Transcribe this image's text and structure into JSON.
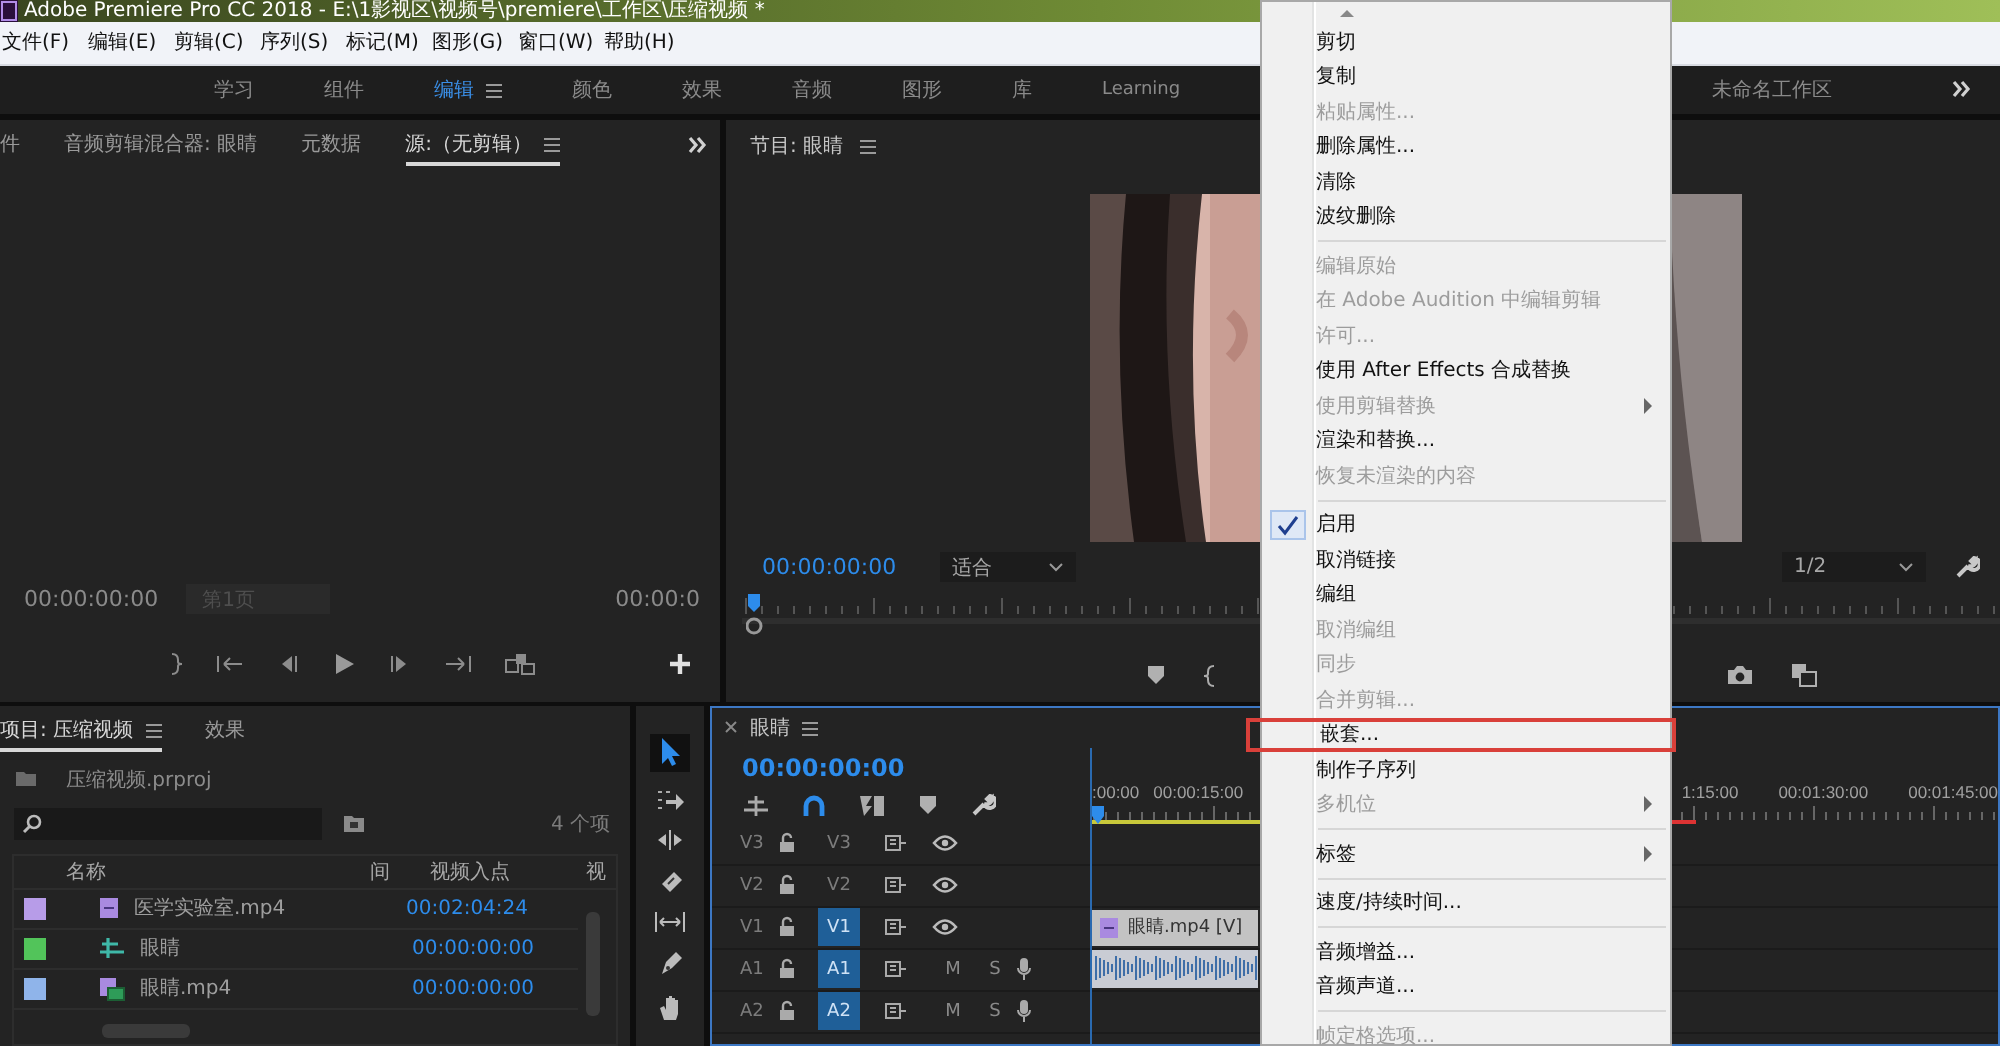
{
  "title_bar": {
    "title": "Adobe Premiere Pro CC 2018 - E:\\1影视区\\视频号\\premiere\\工作区\\压缩视频 *"
  },
  "menu_bar": [
    "文件(F)",
    "编辑(E)",
    "剪辑(C)",
    "序列(S)",
    "标记(M)",
    "图形(G)",
    "窗口(W)",
    "帮助(H)"
  ],
  "workspaces": [
    {
      "label": "学习",
      "selected": false
    },
    {
      "label": "组件",
      "selected": false
    },
    {
      "label": "编辑",
      "selected": true
    },
    {
      "label": "颜色",
      "selected": false
    },
    {
      "label": "效果",
      "selected": false
    },
    {
      "label": "音频",
      "selected": false
    },
    {
      "label": "图形",
      "selected": false
    },
    {
      "label": "库",
      "selected": false
    },
    {
      "label": "Learning",
      "selected": false
    }
  ],
  "workspace_extra": "未命名工作区",
  "source_panel": {
    "tabs": [
      {
        "label": "件",
        "selected": false
      },
      {
        "label": "音频剪辑混合器: 眼睛",
        "selected": false
      },
      {
        "label": "元数据",
        "selected": false
      },
      {
        "label": "源:（无剪辑）",
        "selected": true
      }
    ],
    "timecode": "00:00:00:00",
    "page_field": "第1页",
    "duration": "00:00:0"
  },
  "program_panel": {
    "title": "节目: 眼睛",
    "timecode": "00:00:00:00",
    "fit": "适合",
    "resolution": "1/2"
  },
  "project_panel": {
    "tabs": [
      {
        "label": "项目: 压缩视频",
        "selected": true
      },
      {
        "label": "效果",
        "selected": false
      }
    ],
    "project_file": "压缩视频.prproj",
    "item_count": "4 个项",
    "columns": [
      "名称",
      "间",
      "视频入点",
      "视"
    ],
    "rows": [
      {
        "kind": "media",
        "name": "医学实验室.mp4",
        "in_point": "00:02:04:24",
        "color": "#b79ce8"
      },
      {
        "kind": "sequence",
        "name": "眼睛",
        "in_point": "00:00:00:00",
        "color": "#52c45a"
      },
      {
        "kind": "linked_media",
        "name": "眼睛.mp4",
        "in_point": "00:00:00:00",
        "color": "#8fb4ea"
      }
    ]
  },
  "timeline": {
    "title": "眼睛",
    "timecode": "00:00:00:00",
    "ruler_left": [
      ":00:00",
      "00:00:15:00"
    ],
    "ruler_right": [
      "1:15:00",
      "00:01:30:00",
      "00:01:45:00"
    ],
    "tracks": [
      {
        "kind": "video",
        "label": "V3",
        "target": "V3",
        "targeted": false
      },
      {
        "kind": "video",
        "label": "V2",
        "target": "V2",
        "targeted": false
      },
      {
        "kind": "video",
        "label": "V1",
        "target": "V1",
        "targeted": true,
        "clip": {
          "kind": "video",
          "label": "眼睛.mp4 [V]"
        }
      },
      {
        "kind": "audio",
        "label": "A1",
        "target": "A1",
        "targeted": true,
        "mute": "M",
        "solo": "S",
        "clip": {
          "kind": "audio"
        }
      },
      {
        "kind": "audio",
        "label": "A2",
        "target": "A2",
        "targeted": true,
        "mute": "M",
        "solo": "S"
      }
    ]
  },
  "context_menu": {
    "items": [
      {
        "kind": "item",
        "label": "剪切",
        "disabled": false,
        "checked": false,
        "submenu": false,
        "selected": false
      },
      {
        "kind": "item",
        "label": "复制",
        "disabled": false,
        "checked": false,
        "submenu": false,
        "selected": false
      },
      {
        "kind": "item",
        "label": "粘贴属性...",
        "disabled": true,
        "checked": false,
        "submenu": false,
        "selected": false
      },
      {
        "kind": "item",
        "label": "删除属性...",
        "disabled": false,
        "checked": false,
        "submenu": false,
        "selected": false
      },
      {
        "kind": "item",
        "label": "清除",
        "disabled": false,
        "checked": false,
        "submenu": false,
        "selected": false
      },
      {
        "kind": "item",
        "label": "波纹删除",
        "disabled": false,
        "checked": false,
        "submenu": false,
        "selected": false
      },
      {
        "kind": "separator"
      },
      {
        "kind": "item",
        "label": "编辑原始",
        "disabled": true,
        "checked": false,
        "submenu": false,
        "selected": false
      },
      {
        "kind": "item",
        "label": "在 Adobe Audition 中编辑剪辑",
        "disabled": true,
        "checked": false,
        "submenu": false,
        "selected": false
      },
      {
        "kind": "item",
        "label": "许可...",
        "disabled": true,
        "checked": false,
        "submenu": false,
        "selected": false
      },
      {
        "kind": "item",
        "label": "使用 After Effects 合成替换",
        "disabled": false,
        "checked": false,
        "submenu": false,
        "selected": false
      },
      {
        "kind": "item",
        "label": "使用剪辑替换",
        "disabled": true,
        "checked": false,
        "submenu": true,
        "selected": false
      },
      {
        "kind": "item",
        "label": "渲染和替换...",
        "disabled": false,
        "checked": false,
        "submenu": false,
        "selected": false
      },
      {
        "kind": "item",
        "label": "恢复未渲染的内容",
        "disabled": true,
        "checked": false,
        "submenu": false,
        "selected": false
      },
      {
        "kind": "separator"
      },
      {
        "kind": "item",
        "label": "启用",
        "disabled": false,
        "checked": true,
        "submenu": false,
        "selected": false
      },
      {
        "kind": "item",
        "label": "取消链接",
        "disabled": false,
        "checked": false,
        "submenu": false,
        "selected": false
      },
      {
        "kind": "item",
        "label": "编组",
        "disabled": false,
        "checked": false,
        "submenu": false,
        "selected": false
      },
      {
        "kind": "item",
        "label": "取消编组",
        "disabled": true,
        "checked": false,
        "submenu": false,
        "selected": false
      },
      {
        "kind": "item",
        "label": "同步",
        "disabled": true,
        "checked": false,
        "submenu": false,
        "selected": false
      },
      {
        "kind": "item",
        "label": "合并剪辑...",
        "disabled": true,
        "checked": false,
        "submenu": false,
        "selected": false
      },
      {
        "kind": "item",
        "label": "嵌套...",
        "disabled": false,
        "checked": false,
        "submenu": false,
        "selected": true
      },
      {
        "kind": "item",
        "label": "制作子序列",
        "disabled": false,
        "checked": false,
        "submenu": false,
        "selected": false
      },
      {
        "kind": "item",
        "label": "多机位",
        "disabled": true,
        "checked": false,
        "submenu": true,
        "selected": false
      },
      {
        "kind": "separator"
      },
      {
        "kind": "item",
        "label": "标签",
        "disabled": false,
        "checked": false,
        "submenu": true,
        "selected": false
      },
      {
        "kind": "separator"
      },
      {
        "kind": "item",
        "label": "速度/持续时间...",
        "disabled": false,
        "checked": false,
        "submenu": false,
        "selected": false
      },
      {
        "kind": "separator"
      },
      {
        "kind": "item",
        "label": "音频增益...",
        "disabled": false,
        "checked": false,
        "submenu": false,
        "selected": false
      },
      {
        "kind": "item",
        "label": "音频声道...",
        "disabled": false,
        "checked": false,
        "submenu": false,
        "selected": false
      },
      {
        "kind": "separator"
      },
      {
        "kind": "item",
        "label": "帧定格选项...",
        "disabled": true,
        "checked": false,
        "submenu": false,
        "selected": false
      }
    ]
  }
}
